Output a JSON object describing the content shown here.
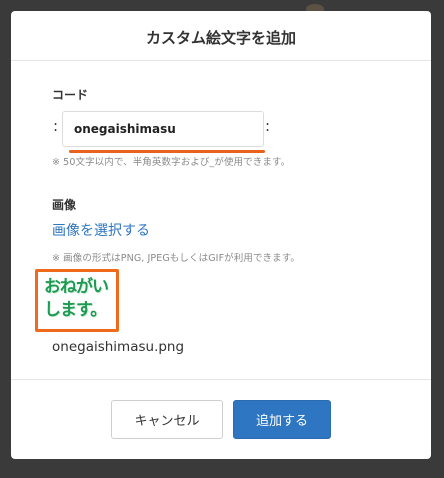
{
  "dialog": {
    "title": "カスタム絵文字を追加"
  },
  "code": {
    "label": "コード",
    "colon_left": ":",
    "colon_right": ":",
    "value": "onegaishimasu",
    "note": "※ 50文字以内で、半角英数字および_が使用できます。"
  },
  "image": {
    "label": "画像",
    "select_link": "画像を選択する",
    "note": "※ 画像の形式はPNG, JPEGもしくはGIFが利用できます。",
    "preview_text": "おねがいします。",
    "file_name": "onegaishimasu.png"
  },
  "footer": {
    "cancel_label": "キャンセル",
    "add_label": "追加する"
  },
  "colors": {
    "accent": "#2f76c2",
    "highlight": "#ef6a1b",
    "emoji_green": "#1f9a52"
  }
}
